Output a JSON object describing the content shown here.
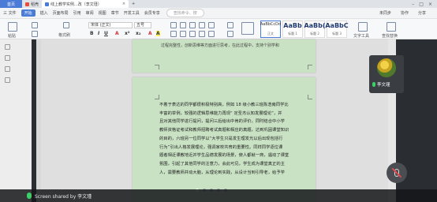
{
  "tabs": {
    "home": "首页",
    "template": "稻壳",
    "document": "线上教学实例...改（李文瑾）"
  },
  "menu": {
    "file": "三 文件",
    "items": [
      "开始",
      "插入",
      "页面布局",
      "引用",
      "审阅",
      "视图",
      "章节",
      "开发工具",
      "会员专享"
    ],
    "search_placeholder": "查找命令、搜",
    "right": [
      "未同步",
      "协作",
      "分享"
    ]
  },
  "ribbon": {
    "paste": "粘贴",
    "format_painter": "格式刷",
    "font_name": "宋体 (正文)",
    "font_size": "五号",
    "styles": [
      {
        "sample": "AaBbCcDd",
        "label": "正文"
      },
      {
        "sample": "AaBb",
        "label": "标题 1"
      },
      {
        "sample": "AaBb(",
        "label": "标题 2"
      },
      {
        "sample": "AaBbC",
        "label": "标题 3"
      }
    ],
    "text_tools": "文字工具",
    "find_replace": "查找替换"
  },
  "document": {
    "page1_line": "过程完整性，创新思维等方面进行思考，在此过程中，支持个别学和",
    "page2_lines": [
      "不着于表达的同学都很积极特别高，例如 18 级小教三班陈浩南同学比",
      "丰富的举例，较强的逻辑思维能力再现“ 定圣杰认知发展理论”，并",
      "且对其他同学进行提问，提问三后给出中肯的评价，同时结合中小学",
      "教师资格证考试和教师招聘考试真题和相应的真题，达到巩固课堂知识",
      "的目的，六班另一位同学以“大学生只是发生理发光以后出现包括行",
      "行为”引出人格发展理论，强调家校共育的重要性。同样同学逐位课",
      "题者相近课教地近并学生品德发展的场景，使人都就一商，遇动了课堂",
      "氛围，引起了其他同学的注意力，会此可见，学生成为课堂真正的主",
      "人，需要教师并动大脑，从理论到实践，从设计当到引导老，给予学"
    ]
  },
  "participant": {
    "name": "李文瑾"
  },
  "share_status": "Screen shared by 李文瑾"
}
